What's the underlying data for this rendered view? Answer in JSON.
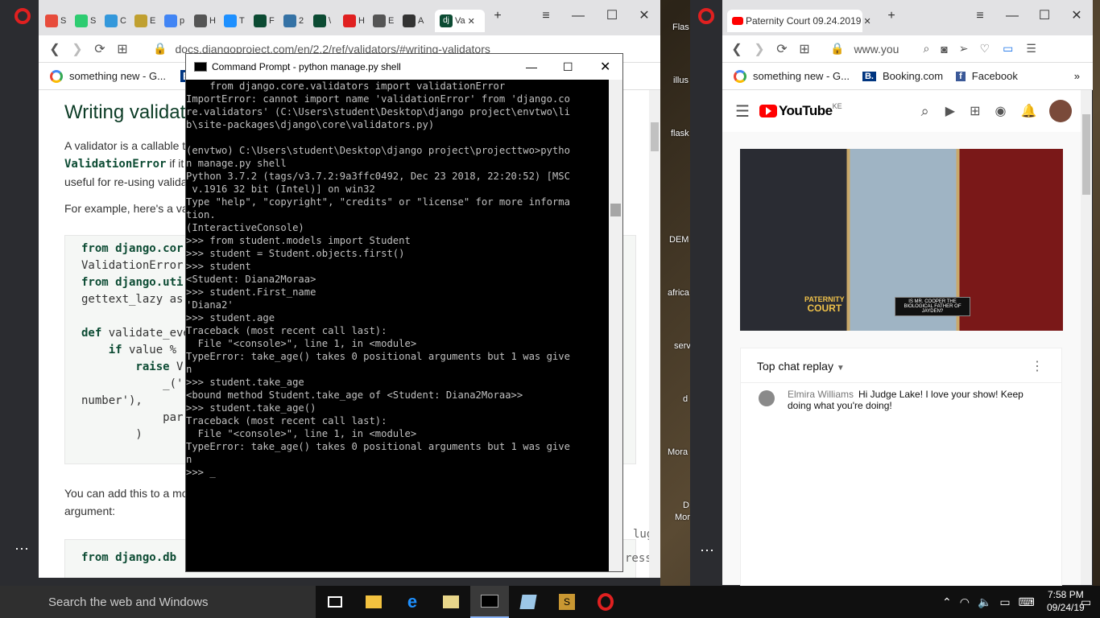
{
  "desktop": {
    "labels": [
      "Flas",
      "illus",
      "flask",
      "DEM",
      "africa",
      "serv",
      "d",
      "Mora",
      "D",
      "Mor"
    ]
  },
  "left_browser": {
    "tabs": [
      "S",
      "S",
      "C",
      "E",
      "p",
      "H",
      "T",
      "F",
      "2",
      "\\",
      "H",
      "E",
      "A"
    ],
    "active_tab": "Va",
    "url": "docs.djangoproject.com/en/2.2/ref/validators/#writing-validators",
    "bookmarks": [
      "something new - G...",
      "B."
    ],
    "page": {
      "heading": "Writing validat",
      "p1a": "A validator is a callable t",
      "p1b": "ValidationError",
      "p1c": " if it",
      "p1d": "useful for re-using valida",
      "p2": "For example, here's a val",
      "code1": [
        {
          "kw": "from ",
          "mod": "django.cor",
          "rest": ""
        },
        {
          "kw": "",
          "mod": "",
          "rest": "ValidationError"
        },
        {
          "kw": "from ",
          "mod": "django.uti",
          "rest": ""
        },
        {
          "kw": "",
          "mod": "",
          "rest": "gettext_lazy as"
        },
        {
          "kw": "",
          "mod": "",
          "rest": ""
        },
        {
          "kw": "def ",
          "mod": "",
          "rest": "validate_eve"
        },
        {
          "kw": "    if ",
          "mod": "",
          "rest": "value %"
        },
        {
          "kw": "        raise ",
          "mod": "",
          "rest": "V"
        },
        {
          "kw": "",
          "mod": "",
          "rest": "            _('"
        },
        {
          "kw": "",
          "mod": "",
          "rest": "number'),"
        },
        {
          "kw": "",
          "mod": "",
          "rest": "            par"
        },
        {
          "kw": "",
          "mod": "",
          "rest": "        )"
        }
      ],
      "p3a": "You can add this to a mo",
      "p3b": "argument:",
      "code2": "from django.db",
      "frag1": "lug",
      "frag2": "ress"
    }
  },
  "cmd": {
    "title": "Command Prompt - python  manage.py shell",
    "lines": [
      "    from django.core.validators import validationError",
      "ImportError: cannot import name 'validationError' from 'django.co",
      "re.validators' (C:\\Users\\student\\Desktop\\django project\\envtwo\\li",
      "b\\site-packages\\django\\core\\validators.py)",
      "",
      "(envtwo) C:\\Users\\student\\Desktop\\django project\\projecttwo>pytho",
      "n manage.py shell",
      "Python 3.7.2 (tags/v3.7.2:9a3ffc0492, Dec 23 2018, 22:20:52) [MSC",
      " v.1916 32 bit (Intel)] on win32",
      "Type \"help\", \"copyright\", \"credits\" or \"license\" for more informa",
      "tion.",
      "(InteractiveConsole)",
      ">>> from student.models import Student",
      ">>> student = Student.objects.first()",
      ">>> student",
      "<Student: Diana2Moraa>",
      ">>> student.First_name",
      "'Diana2'",
      ">>> student.age",
      "Traceback (most recent call last):",
      "  File \"<console>\", line 1, in <module>",
      "TypeError: take_age() takes 0 positional arguments but 1 was give",
      "n",
      ">>> student.take_age",
      "<bound method Student.take_age of <Student: Diana2Moraa>>",
      ">>> student.take_age()",
      "Traceback (most recent call last):",
      "  File \"<console>\", line 1, in <module>",
      "TypeError: take_age() takes 0 positional arguments but 1 was give",
      "n",
      ">>> _"
    ]
  },
  "right_browser": {
    "tab_title": "Paternity Court 09.24.2019",
    "url": "www.you",
    "bookmarks": [
      "something new - G...",
      "Booking.com",
      "Facebook"
    ],
    "yt_logo": "YouTube",
    "yt_region": "KE",
    "video_brand": [
      "PATERNITY",
      "COURT"
    ],
    "video_caption": "IS MR. COOPER THE BIOLOGICAL FATHER OF JAYDEN?",
    "chat_header": "Top chat replay",
    "chat_author": "Elmira Williams",
    "chat_message": "Hi Judge Lake! I love your show! Keep doing what you're doing!"
  },
  "taskbar": {
    "search_placeholder": "Search the web and Windows",
    "time": "7:58 PM",
    "date": "09/24/19"
  }
}
